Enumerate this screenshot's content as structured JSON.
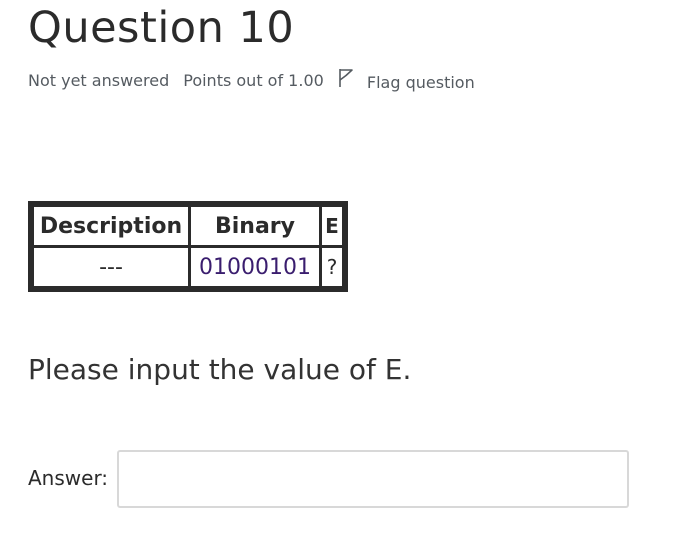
{
  "question": {
    "title": "Question 10",
    "status": "Not yet answered",
    "points": "Points out of 1.00",
    "flag_label": "Flag question"
  },
  "table": {
    "headers": [
      "Description",
      "Binary",
      "E"
    ],
    "row": [
      "---",
      "01000101",
      "?"
    ]
  },
  "prompt": "Please input the value of E.",
  "answer": {
    "label": "Answer:",
    "value": ""
  }
}
